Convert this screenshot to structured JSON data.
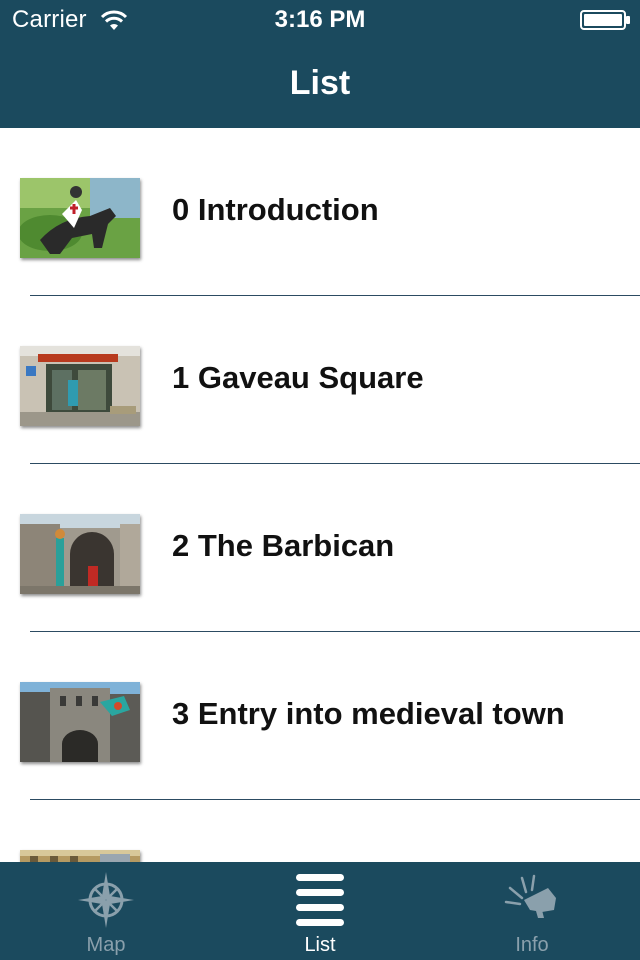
{
  "status_bar": {
    "carrier": "Carrier",
    "time": "3:16 PM",
    "icons": [
      "wifi-icon",
      "battery-icon"
    ]
  },
  "nav": {
    "title": "List"
  },
  "list": {
    "items": [
      {
        "label": "0 Introduction",
        "thumbnail": "knight-on-horse-image"
      },
      {
        "label": "1 Gaveau Square",
        "thumbnail": "tourist-office-image"
      },
      {
        "label": "2 The Barbican",
        "thumbnail": "barbican-gate-image"
      },
      {
        "label": "3 Entry into medieval town",
        "thumbnail": "medieval-town-entry-image"
      },
      {
        "label": "",
        "thumbnail": "building-facade-image"
      }
    ]
  },
  "tabbar": {
    "tabs": [
      {
        "label": "Map",
        "icon": "compass-icon",
        "selected": false
      },
      {
        "label": "List",
        "icon": "list-icon",
        "selected": true
      },
      {
        "label": "Info",
        "icon": "horn-icon",
        "selected": false
      }
    ]
  },
  "colors": {
    "bar_background": "#1b4a5e",
    "separator": "#2c4b62",
    "tab_inactive": "#8aa0ac",
    "tab_active": "#ffffff"
  }
}
